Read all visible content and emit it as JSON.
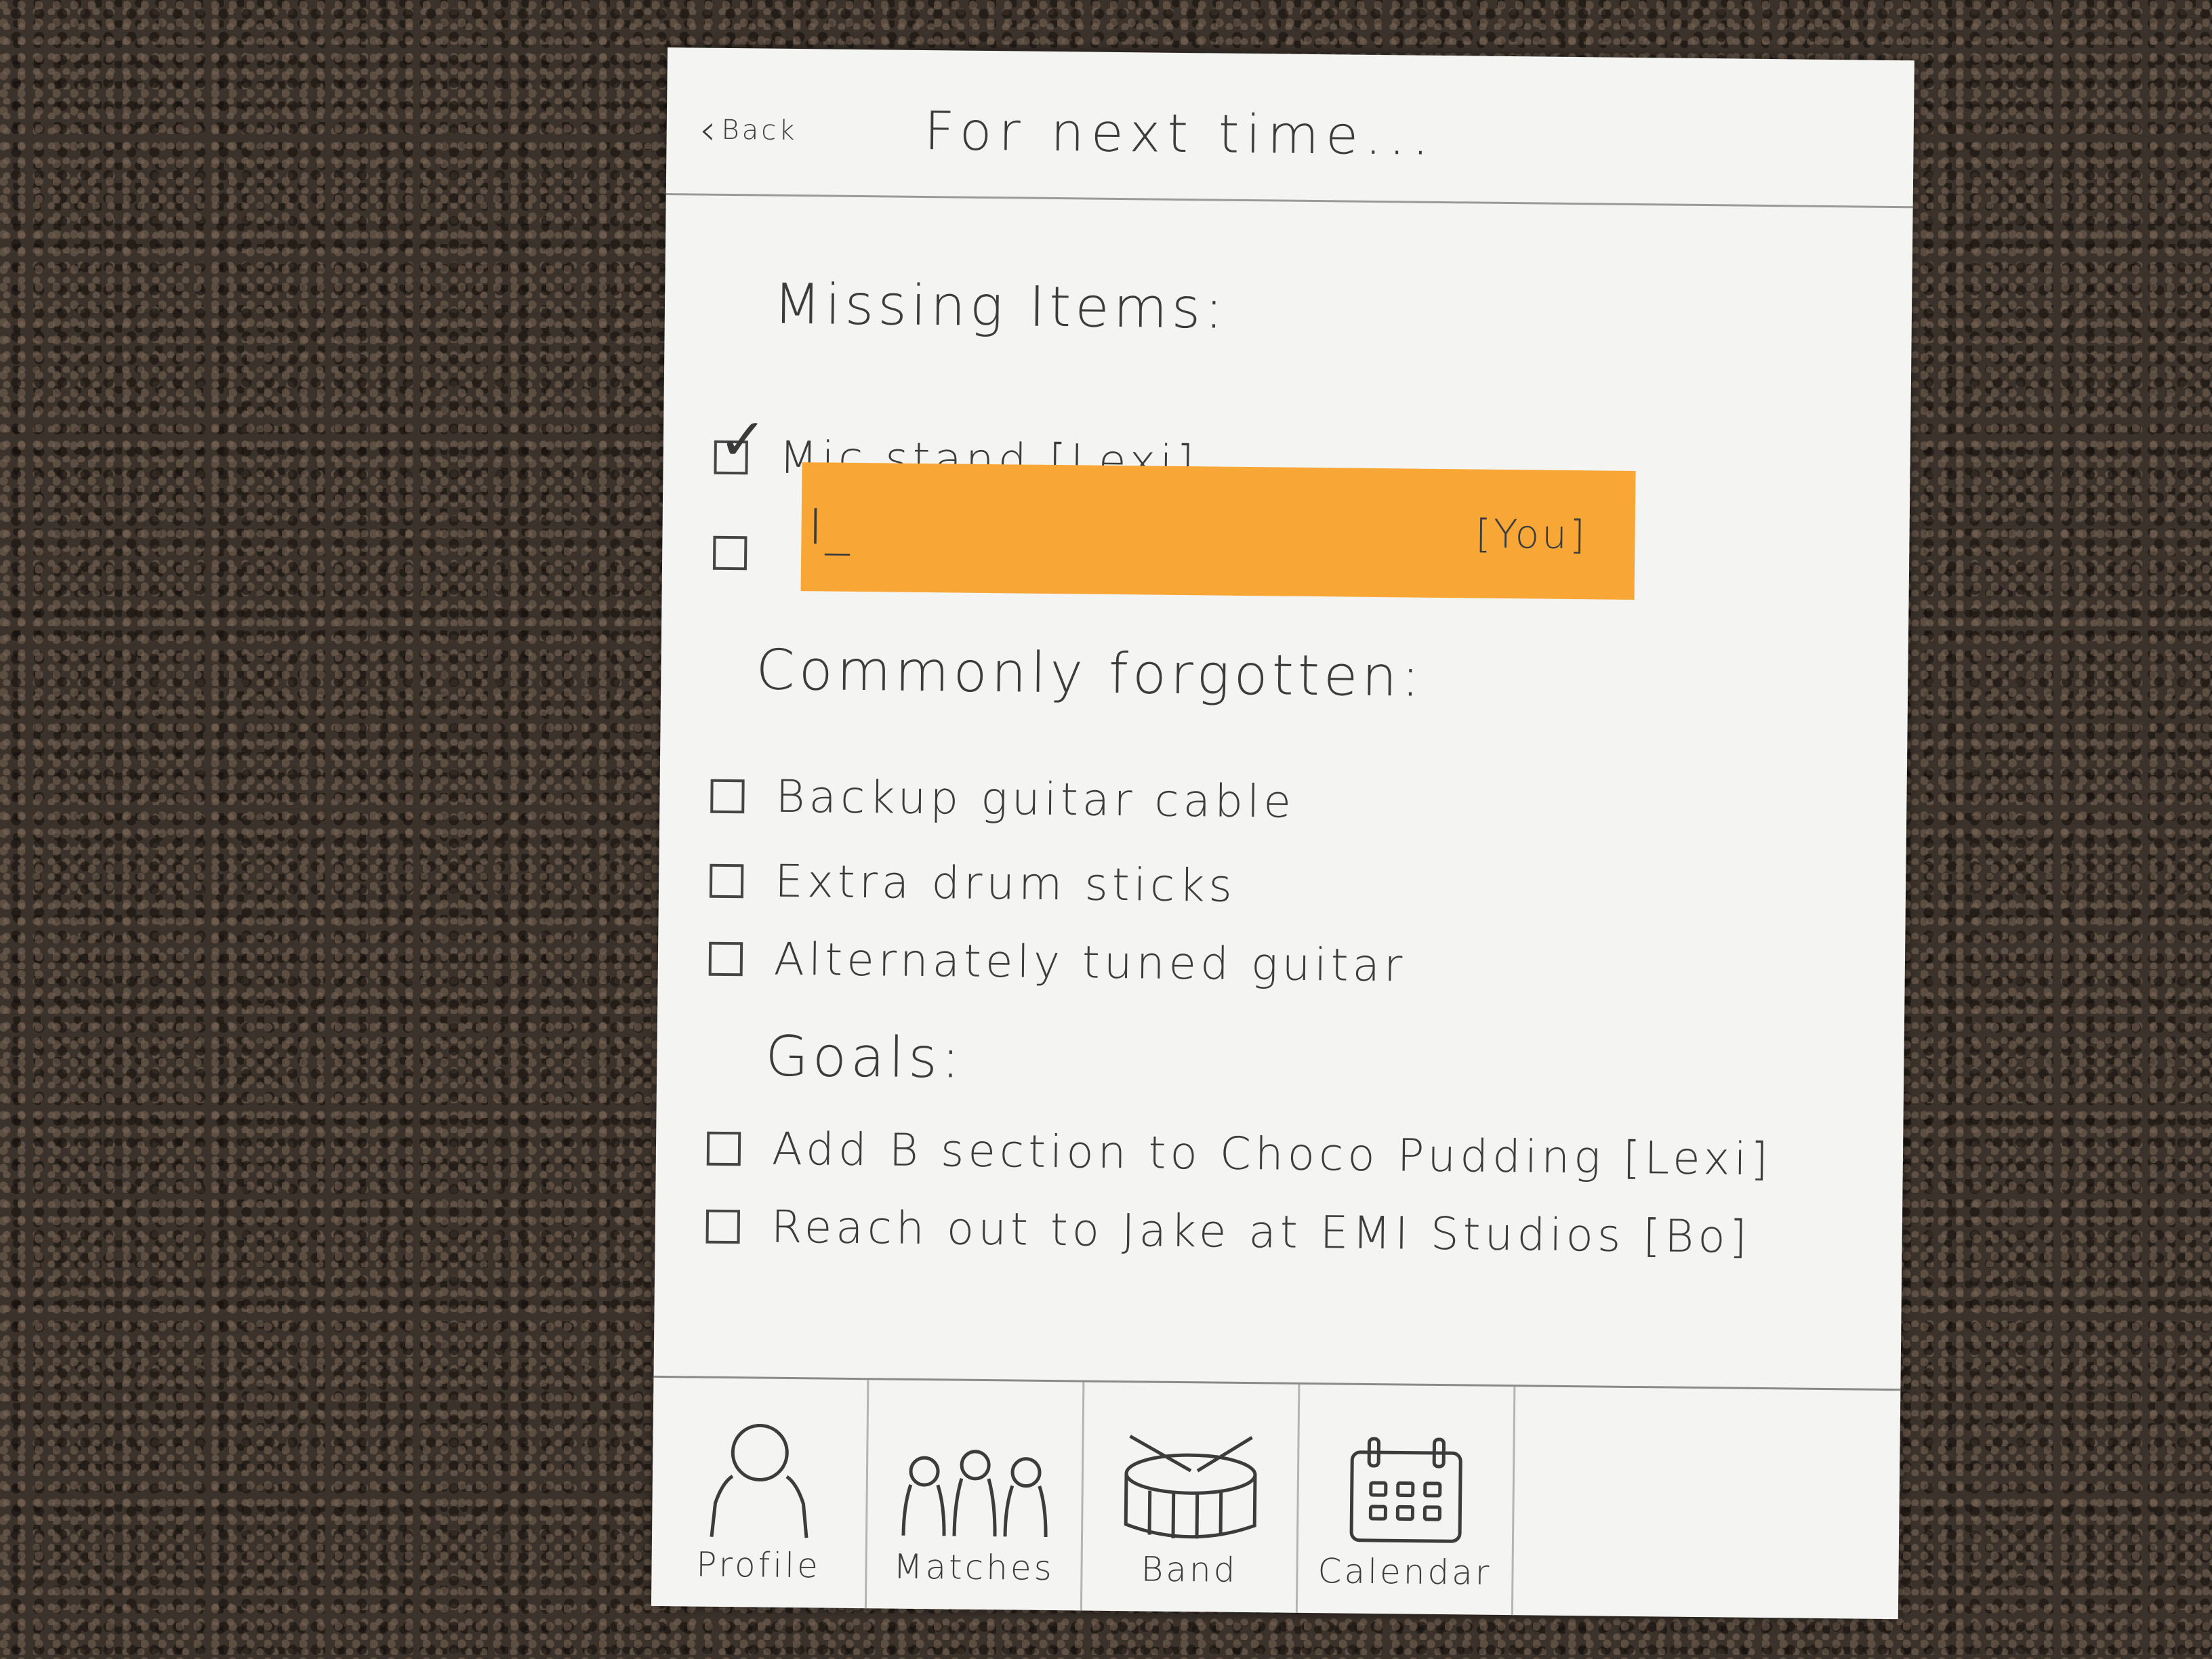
{
  "header": {
    "back_label": "Back",
    "title": "For next time..."
  },
  "missing_items": {
    "heading": "Missing Items:",
    "items": [
      {
        "label": "Mic stand [Lexi]",
        "checked": true
      },
      {
        "label": "",
        "checked": false
      }
    ],
    "new_entry": {
      "value": "I_",
      "assignee": "[You]",
      "highlight_color": "#f8a635"
    }
  },
  "commonly_forgotten": {
    "heading": "Commonly forgotten:",
    "items": [
      {
        "label": "Backup guitar cable",
        "checked": false
      },
      {
        "label": "Extra drum sticks",
        "checked": false
      },
      {
        "label": "Alternately tuned guitar",
        "checked": false
      }
    ]
  },
  "goals": {
    "heading": "Goals:",
    "items": [
      {
        "label": "Add B section to Choco Pudding [Lexi]",
        "checked": false
      },
      {
        "label": "Reach out to Jake at EMI Studios [Bo]",
        "checked": false
      }
    ]
  },
  "tab_bar": {
    "tabs": [
      {
        "label": "Profile",
        "icon": "person-icon"
      },
      {
        "label": "Matches",
        "icon": "people-icon"
      },
      {
        "label": "Band",
        "icon": "drum-icon"
      },
      {
        "label": "Calendar",
        "icon": "calendar-icon"
      }
    ]
  }
}
